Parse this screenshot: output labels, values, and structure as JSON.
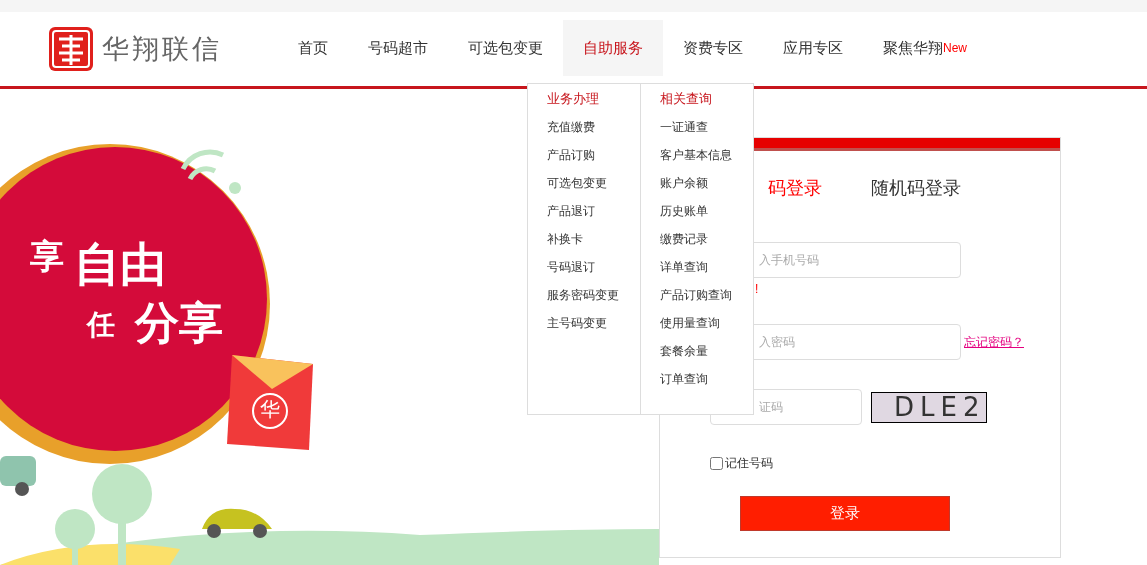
{
  "header": {
    "brand": "华翔联信"
  },
  "nav": [
    {
      "label": "首页",
      "selected": false
    },
    {
      "label": "号码超市",
      "selected": false
    },
    {
      "label": "可选包变更",
      "selected": false
    },
    {
      "label": "自助服务",
      "selected": true
    },
    {
      "label": "资费专区",
      "selected": false
    },
    {
      "label": "应用专区",
      "selected": false
    },
    {
      "label": "聚焦华翔",
      "selected": false,
      "badge": "New"
    }
  ],
  "dropdown": {
    "columns": [
      {
        "title": "业务办理",
        "items": [
          "充值缴费",
          "产品订购",
          "可选包变更",
          "产品退订",
          "补换卡",
          "号码退订",
          "服务密码变更",
          "主号码变更"
        ]
      },
      {
        "title": "相关查询",
        "items": [
          "一证通查",
          "客户基本信息",
          "账户余额",
          "历史账单",
          "缴费记录",
          "详单查询",
          "产品订购查询",
          "使用量查询",
          "套餐余量",
          "订单查询"
        ]
      }
    ]
  },
  "banner": {
    "slogan": [
      "享",
      "自由",
      "任",
      "分享"
    ],
    "envelope_mark": "华"
  },
  "login": {
    "tabs": [
      {
        "label": "码登录",
        "selected": true
      },
      {
        "label": "随机码登录",
        "selected": false
      }
    ],
    "phone": {
      "placeholder": "入手机号码"
    },
    "phone_error": "!",
    "password": {
      "placeholder": "入密码"
    },
    "forgot_link": "忘记密码？",
    "captcha": {
      "placeholder": "证码"
    },
    "captcha_image": "DLE2",
    "remember": {
      "label": "记住号码",
      "checked": false
    },
    "submit": "登录"
  }
}
